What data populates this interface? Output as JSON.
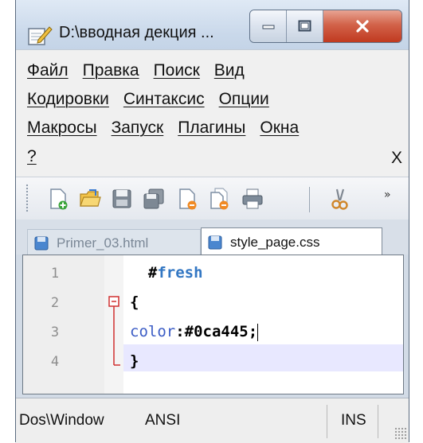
{
  "window": {
    "title": "D:\\вводная декция ...",
    "app_icon": "notepad-edit-icon",
    "caption": {
      "minimize_icon": "minimize-icon",
      "maximize_icon": "maximize-icon",
      "close_icon": "close-icon"
    }
  },
  "menu": {
    "rows": [
      [
        "Файл",
        "Правка",
        "Поиск",
        "Вид"
      ],
      [
        "Кодировки",
        "Синтаксис",
        "Опции"
      ],
      [
        "Макросы",
        "Запуск",
        "Плагины",
        "Окна"
      ],
      [
        "?"
      ]
    ],
    "close_label": "X"
  },
  "toolbar": {
    "buttons": [
      "new-file-icon",
      "open-file-icon",
      "save-icon",
      "save-all-icon",
      "close-file-icon",
      "close-all-icon",
      "print-icon",
      "cut-icon"
    ],
    "overflow": "»"
  },
  "tabs": [
    {
      "label": "Primer_03.html",
      "active": false
    },
    {
      "label": "style_page.css",
      "active": true
    }
  ],
  "editor": {
    "lines": [
      {
        "number": "1",
        "tokens": [
          {
            "text": "#",
            "cls": "tok-id"
          },
          {
            "text": "fresh",
            "cls": "tok-id-name"
          }
        ]
      },
      {
        "number": "2",
        "tokens": [
          {
            "text": "{",
            "cls": "tok-brace"
          }
        ]
      },
      {
        "number": "3",
        "tokens": [
          {
            "text": "color",
            "cls": "tok-prop"
          },
          {
            "text": ":#0ca445;",
            "cls": "tok-val"
          }
        ]
      },
      {
        "number": "4",
        "tokens": [
          {
            "text": "}",
            "cls": "tok-brace"
          }
        ]
      }
    ],
    "current_line": 3,
    "fold_marker": "fold-minus-icon"
  },
  "status": {
    "eol": "Dos\\Window",
    "encoding": "ANSI",
    "mode": "INS"
  },
  "colors": {
    "selector": "#3377c3",
    "property": "#3b5cc5",
    "current_line": "#e8e8ff",
    "fold_marker": "#d03030"
  }
}
